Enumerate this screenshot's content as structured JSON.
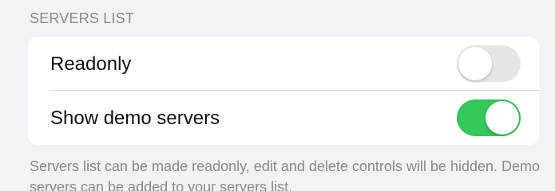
{
  "section": {
    "header": "SERVERS LIST",
    "footer": "Servers list can be made readonly, edit and delete controls will be hidden. Demo servers can be added to your servers list."
  },
  "rows": [
    {
      "label": "Readonly",
      "toggle_on": false
    },
    {
      "label": "Show demo servers",
      "toggle_on": true
    }
  ],
  "colors": {
    "toggle_on": "#34c759",
    "toggle_off": "#e6e6ea",
    "background": "#f2f2f7"
  }
}
